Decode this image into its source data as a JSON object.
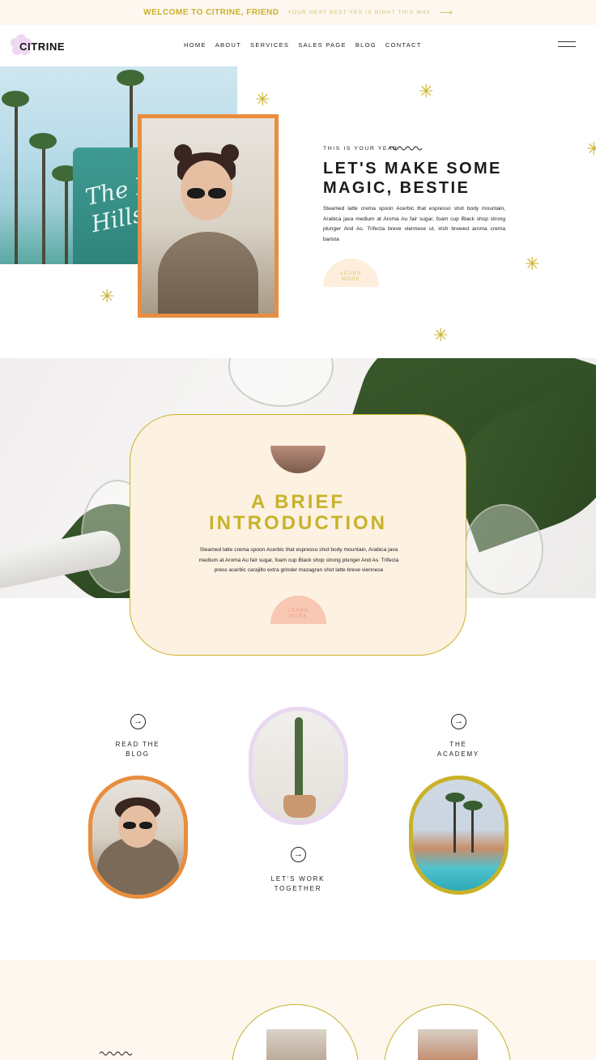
{
  "announcement": {
    "title": "WELCOME TO CITRINE, FRIEND",
    "subtitle": "YOUR NEXT BEST YES IS RIGHT THIS WAY",
    "arrow": "⟶"
  },
  "brand": {
    "name": "CITRINE",
    "accent": "#c9b22a",
    "orange": "#e98d3e",
    "peach": "#fdf1e2",
    "blush": "#f8c8b4",
    "lilac": "#e8d8f0"
  },
  "nav": {
    "items": [
      "HOME",
      "ABOUT",
      "SERVICES",
      "SALES PAGE",
      "BLOG",
      "CONTACT"
    ],
    "menu_icon": "hamburger-icon"
  },
  "hero": {
    "eyebrow": "THIS IS YOUR YEAR",
    "title": "LET'S MAKE SOME MAGIC, BESTIE",
    "body": "Steamed latte crema spoon Acerbic that espresso shot body mountain, Arabica java medium at Aroma Au fair sugar, foam cup Black shop strong plunger And As. Trifecta breve viennese ut, irish brewed aroma crema barista",
    "button": "LEARN\nMORE",
    "photo_sign": "The Bever\nHills"
  },
  "intro": {
    "title": "A BRIEF\nINTRODUCTION",
    "body": "Steamed latte crema spoon Acerbic that espresso shot body mountain, Arabica java medium at Aroma Au fair sugar, foam cup Black shop strong plunger And As. Trifecta press acerbic carajillo extra grinder mazagran shot latte breve viennese",
    "button": "LEARN\nMORE"
  },
  "tiles": {
    "blog": "READ THE\nBLOG",
    "work": "LET'S WORK\nTOGETHER",
    "academy": "THE\nACADEMY",
    "arrow": "→"
  }
}
